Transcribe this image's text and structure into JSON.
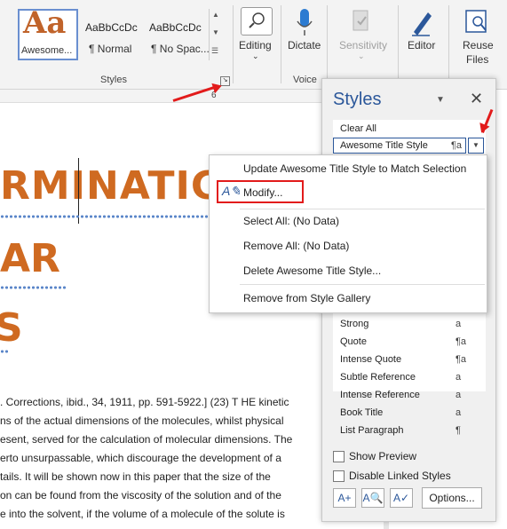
{
  "ribbon": {
    "gallery": [
      {
        "preview": "Aa",
        "caption": "Awesome..."
      },
      {
        "preview": "AaBbCcDc",
        "caption": "¶ Normal"
      },
      {
        "preview": "AaBbCcDc",
        "caption": "¶ No Spac..."
      }
    ],
    "groups": {
      "styles": "Styles",
      "voice": "Voice",
      "sensitivity_frag": "Sensitivit",
      "editor_frag": "Edito",
      "reuse_frag": "Reuse Files"
    },
    "buttons": {
      "editing": "Editing",
      "dictate": "Dictate",
      "sensitivity": "Sensitivity",
      "editor": "Editor",
      "reuse_files_1": "Reuse",
      "reuse_files_2": "Files"
    },
    "ruler_mark": "6"
  },
  "document": {
    "heading_lines": [
      "RMINATIC",
      "AR",
      "S"
    ],
    "body_lines": [
      ". Corrections, ibid., 34, 1911, pp. 591-5922.] (23) T HE kinetic",
      "ns of the actual dimensions of the molecules, whilst physical",
      "esent, served for the calculation of molecular dimensions. The",
      "erto unsurpassable, which discourage the development of a",
      "tails. It will be shown now in this paper that the size of the",
      "on can be found from the viscosity of the solution and of the",
      "e into the solvent, if the volume of a molecule of the solute is"
    ]
  },
  "styles_pane": {
    "title": "Styles",
    "clear_all": "Clear All",
    "selected_style": "Awesome Title Style",
    "selected_glyph": "¶a",
    "styles": [
      {
        "name": "Strong",
        "glyph": "a"
      },
      {
        "name": "Quote",
        "glyph": "¶a"
      },
      {
        "name": "Intense Quote",
        "glyph": "¶a"
      },
      {
        "name": "Subtle Reference",
        "glyph": "a"
      },
      {
        "name": "Intense Reference",
        "glyph": "a"
      },
      {
        "name": "Book Title",
        "glyph": "a"
      },
      {
        "name": "List Paragraph",
        "glyph": "¶"
      }
    ],
    "show_preview": "Show Preview",
    "disable_linked": "Disable Linked Styles",
    "options": "Options..."
  },
  "context_menu": {
    "items": [
      "Update Awesome Title Style to Match Selection",
      "Modify...",
      "Select All: (No Data)",
      "Remove All: (No Data)",
      "Delete Awesome Title Style...",
      "Remove from Style Gallery"
    ]
  },
  "colors": {
    "accent": "#2b579a",
    "highlight_red": "#e21b1b",
    "title_orange": "#cf6a21"
  }
}
